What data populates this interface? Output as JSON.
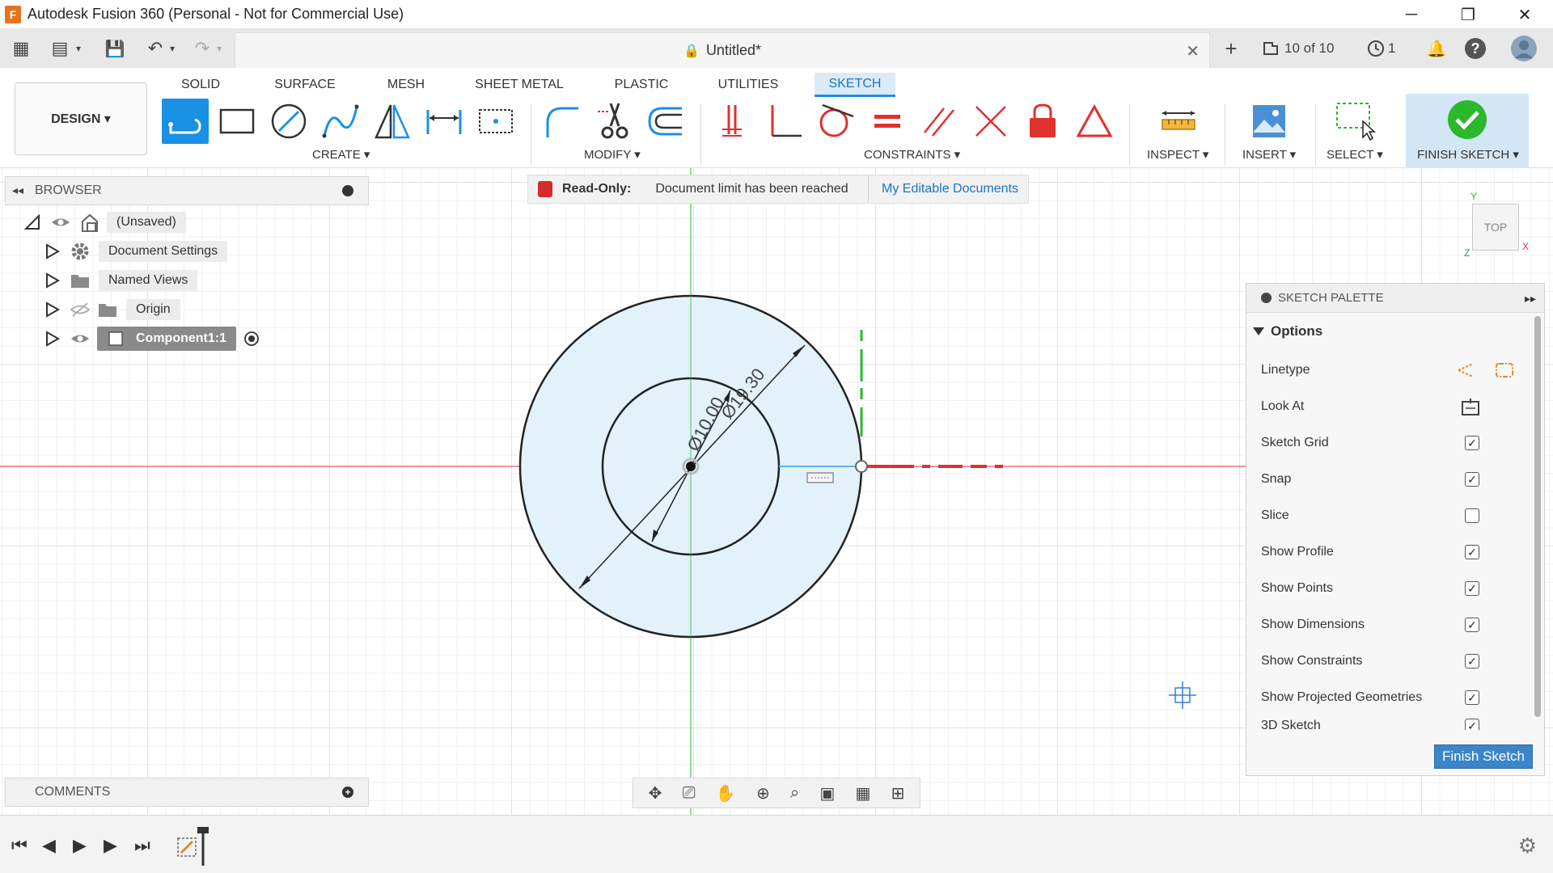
{
  "window": {
    "title": "Autodesk Fusion 360 (Personal - Not for Commercial Use)",
    "logo": "F",
    "minimize": "─",
    "restore": "❐",
    "close": "✕"
  },
  "qa": {
    "grid_icon": "▦",
    "file_icon": "▤",
    "save_icon": "💾",
    "undo_icon": "↶",
    "redo_icon": "↷",
    "add_tab": "+",
    "versions": "10 of 10",
    "jobs_count": "1",
    "bell_icon": "🔔",
    "help_icon": "?",
    "dropdown_arrow": "▾"
  },
  "document": {
    "title": "Untitled*",
    "lock_icon": "🔒",
    "close": "✕"
  },
  "ribbon": {
    "tabs": [
      "SOLID",
      "SURFACE",
      "MESH",
      "SHEET METAL",
      "PLASTIC",
      "UTILITIES",
      "SKETCH"
    ],
    "active_tab": "SKETCH",
    "workspace": "DESIGN ▾",
    "groups": {
      "create": "CREATE ▾",
      "modify": "MODIFY ▾",
      "constraints": "CONSTRAINTS ▾",
      "inspect": "INSPECT ▾",
      "insert": "INSERT ▾",
      "select": "SELECT ▾",
      "finish": "FINISH SKETCH ▾"
    }
  },
  "colors": {
    "accent": "#1a90e5",
    "x_axis": "#e03030",
    "y_axis": "#2bb82b",
    "profile_fill": "#e3f1fb",
    "readonly_red": "#d62b2b"
  },
  "browser": {
    "title": "BROWSER",
    "collapse_icon": "◂◂",
    "items": [
      {
        "label": "(Unsaved)"
      },
      {
        "label": "Document Settings"
      },
      {
        "label": "Named Views"
      },
      {
        "label": "Origin"
      },
      {
        "label": "Component1:1"
      }
    ]
  },
  "banner": {
    "readonly": "Read-Only:",
    "message": "Document limit has been reached",
    "link": "My Editable Documents"
  },
  "viewcube": {
    "face": "TOP",
    "y": "Y",
    "x": "X",
    "z": "Z"
  },
  "sketch": {
    "dim_inner": "Ø10.00",
    "dim_outer": "Ø19.30"
  },
  "palette": {
    "title": "SKETCH PALETTE",
    "expand_icon": "▸▸",
    "options_label": "Options",
    "rows": [
      {
        "label": "Linetype"
      },
      {
        "label": "Look At"
      },
      {
        "label": "Sketch Grid",
        "checked": true
      },
      {
        "label": "Snap",
        "checked": true
      },
      {
        "label": "Slice",
        "checked": false
      },
      {
        "label": "Show Profile",
        "checked": true
      },
      {
        "label": "Show Points",
        "checked": true
      },
      {
        "label": "Show Dimensions",
        "checked": true
      },
      {
        "label": "Show Constraints",
        "checked": true
      },
      {
        "label": "Show Projected Geometries",
        "checked": true
      },
      {
        "label": "3D Sketch",
        "checked": true
      }
    ],
    "checkmark": "✓",
    "finish_button": "Finish Sketch"
  },
  "comments": {
    "title": "COMMENTS",
    "add_icon": "+"
  },
  "navbar": {
    "orbit": "✥",
    "look": "⎚",
    "pan": "✋",
    "zoom": "⊕",
    "fit": "⌕",
    "display": "▣",
    "grid": "▦",
    "viewports": "⊞"
  },
  "timeline": {
    "first": "⏮",
    "prev": "◀",
    "play": "▶",
    "next": "▶",
    "last": "⏭",
    "settings_icon": "⚙"
  }
}
